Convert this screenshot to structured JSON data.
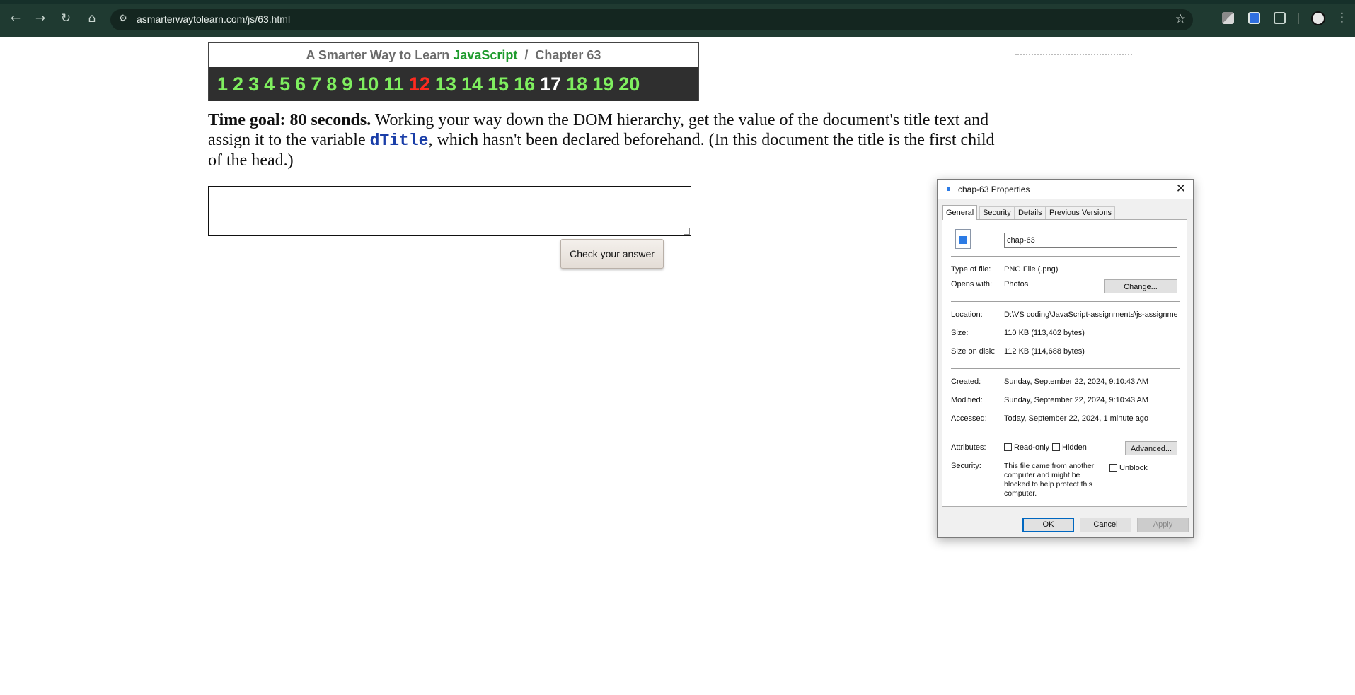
{
  "browser": {
    "url": "asmarterwaytolearn.com/js/63.html",
    "icons": [
      "back-icon",
      "forward-icon",
      "reload-icon",
      "home-icon",
      "site-settings-icon",
      "bookmark-star-icon",
      "extension-icon",
      "puzzle-icon",
      "profile-avatar",
      "more-menu-icon"
    ]
  },
  "page": {
    "header_prefix": "A Smarter Way to Learn",
    "header_brand": "JavaScript",
    "header_sep": "/",
    "header_chapter": "Chapter 63",
    "exercise_links": [
      {
        "label": "1"
      },
      {
        "label": "2"
      },
      {
        "label": "3"
      },
      {
        "label": "4"
      },
      {
        "label": "5"
      },
      {
        "label": "6"
      },
      {
        "label": "7"
      },
      {
        "label": "8"
      },
      {
        "label": "9"
      },
      {
        "label": "10"
      },
      {
        "label": "11"
      },
      {
        "label": "12",
        "state": "current"
      },
      {
        "label": "13"
      },
      {
        "label": "14"
      },
      {
        "label": "15"
      },
      {
        "label": "16"
      },
      {
        "label": "17",
        "state": "visited"
      },
      {
        "label": "18"
      },
      {
        "label": "19"
      },
      {
        "label": "20"
      }
    ],
    "time_goal": "Time goal: 80 seconds.",
    "instruction_part1": " Working your way down the DOM hierarchy, get the value of the document's title text and assign it to the variable ",
    "instruction_code": "dTitle",
    "instruction_part2": ", which hasn't been declared beforehand. (In this document the title is the first child of the head.)",
    "answer_value": "",
    "check_button": "Check your answer",
    "colors": {
      "link_green": "#7fef5f",
      "current_red": "#ff2a1f",
      "brand_green": "#1e9b2d",
      "code_blue": "#1a3ea8"
    }
  },
  "dialog": {
    "title": "chap-63 Properties",
    "tabs": [
      "General",
      "Security",
      "Details",
      "Previous Versions"
    ],
    "active_tab": "General",
    "file_name": "chap-63",
    "type_label": "Type of file:",
    "type_value": "PNG File (.png)",
    "opens_label": "Opens with:",
    "opens_value": "Photos",
    "change_button": "Change...",
    "location_label": "Location:",
    "location_value": "D:\\VS coding\\JavaScript-assignments\\js-assignments",
    "size_label": "Size:",
    "size_value": "110 KB (113,402 bytes)",
    "size_disk_label": "Size on disk:",
    "size_disk_value": "112 KB (114,688 bytes)",
    "created_label": "Created:",
    "created_value": "Sunday, September 22, 2024, 9:10:43 AM",
    "modified_label": "Modified:",
    "modified_value": "Sunday, September 22, 2024, 9:10:43 AM",
    "accessed_label": "Accessed:",
    "accessed_value": "Today, September 22, 2024, 1 minute ago",
    "attributes_label": "Attributes:",
    "readonly_label": "Read-only",
    "hidden_label": "Hidden",
    "advanced_button": "Advanced...",
    "security_label": "Security:",
    "security_text": "This file came from another computer and might be blocked to help protect this computer.",
    "unblock_label": "Unblock",
    "ok_button": "OK",
    "cancel_button": "Cancel",
    "apply_button": "Apply"
  }
}
